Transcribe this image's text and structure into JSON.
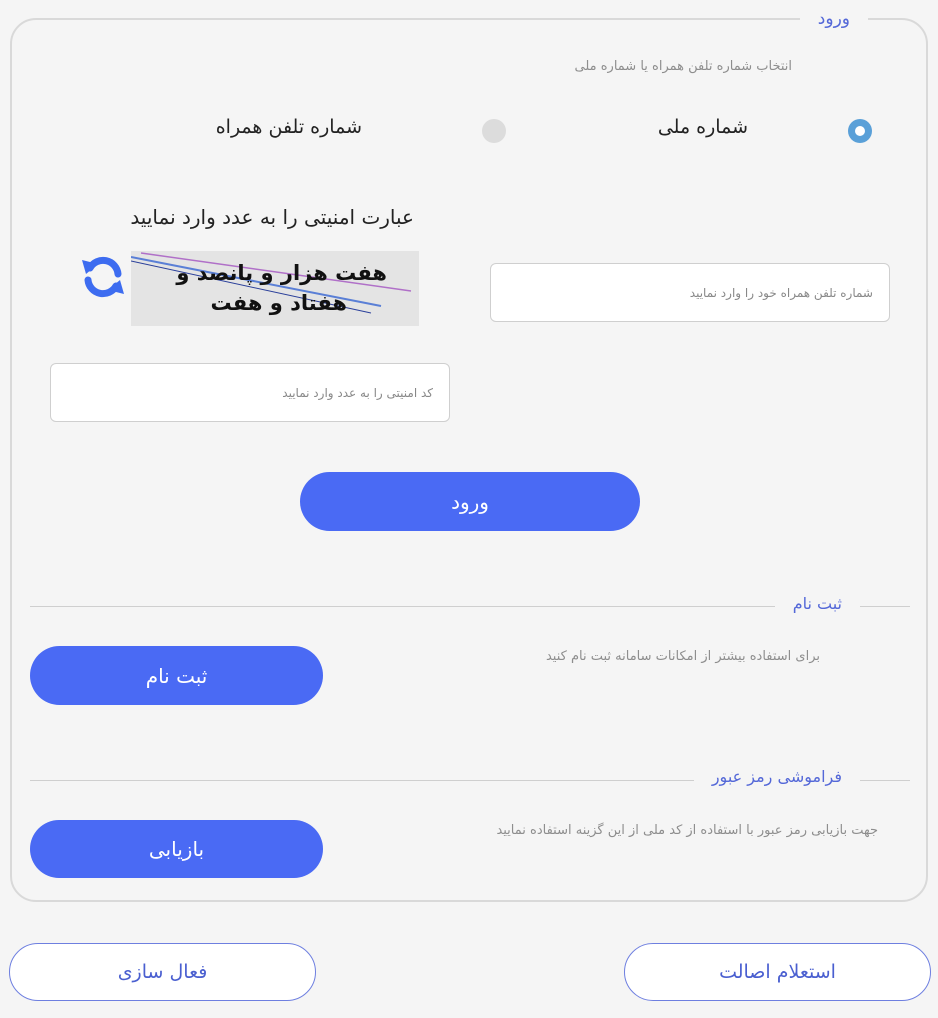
{
  "login": {
    "legend": "ورود",
    "select_hint": "انتخاب شماره تلفن همراه یا شماره ملی",
    "option_national": "شماره ملی",
    "option_mobile": "شماره تلفن همراه",
    "selected": "national",
    "captcha_title": "عبارت امنیتی را به عدد وارد نمایید",
    "captcha_line1": "هفت هزار و پانصد و",
    "captcha_line2": "هفتاد و هفت",
    "mobile_placeholder": "شماره تلفن همراه خود را وارد نمایید",
    "captcha_placeholder": "کد امنیتی را به عدد وارد نمایید",
    "submit_label": "ورود"
  },
  "register": {
    "title": "ثبت نام",
    "hint": "برای استفاده بیشتر از امکانات سامانه ثبت نام کنید",
    "button_label": "ثبت نام"
  },
  "forgot": {
    "title": "فراموشی رمز عبور",
    "hint": "جهت بازیابی رمز عبور با استفاده از کد ملی از این گزینه استفاده نمایید",
    "button_label": "بازیابی"
  },
  "footer": {
    "inquiry_label": "استعلام اصالت",
    "activate_label": "فعال سازی"
  },
  "colors": {
    "primary": "#4a6af4",
    "accent_text": "#5468d8",
    "radio_on": "#5aa0d8"
  },
  "icons": {
    "refresh": "refresh-icon"
  }
}
